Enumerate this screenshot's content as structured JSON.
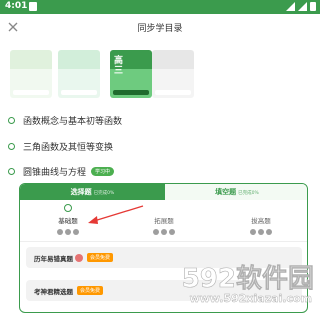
{
  "status": {
    "time": "4:01"
  },
  "header": {
    "title": "同步学目录"
  },
  "books": [
    {
      "chars": "",
      "faded": true,
      "top": "#a8d8a0",
      "bottom": "#d8efd6"
    },
    {
      "chars": "",
      "faded": true,
      "top": "#7fd097",
      "bottom": "#c3e9cf"
    },
    {
      "chars": "高\n三",
      "faded": false,
      "top": "#3b9b4d",
      "bottom": "#6ecb7f"
    },
    {
      "chars": "",
      "faded": true,
      "top": "#bdbdbd",
      "bottom": "#e0e0e0"
    }
  ],
  "chapters": [
    {
      "label": "函数概念与基本初等函数",
      "badge": ""
    },
    {
      "label": "三角函数及其恒等变换",
      "badge": ""
    },
    {
      "label": "圆锥曲线与方程",
      "badge": "学习中"
    }
  ],
  "tabs": [
    {
      "label": "选择题",
      "sub": "已完成0%"
    },
    {
      "label": "填空题",
      "sub": "已完成0%"
    }
  ],
  "levels": [
    {
      "label": "基础题"
    },
    {
      "label": "拓展题"
    },
    {
      "label": "拔高题"
    }
  ],
  "sets": [
    {
      "label": "历年易错真题",
      "badge": "会员免费"
    },
    {
      "label": "考神君精选题",
      "badge": "会员免费"
    }
  ],
  "watermark": {
    "big": "592软件园",
    "small": "www.592xiazai.com"
  },
  "colors": {
    "brand_green": "#3b9b4d",
    "badge_orange": "#ff9800"
  }
}
